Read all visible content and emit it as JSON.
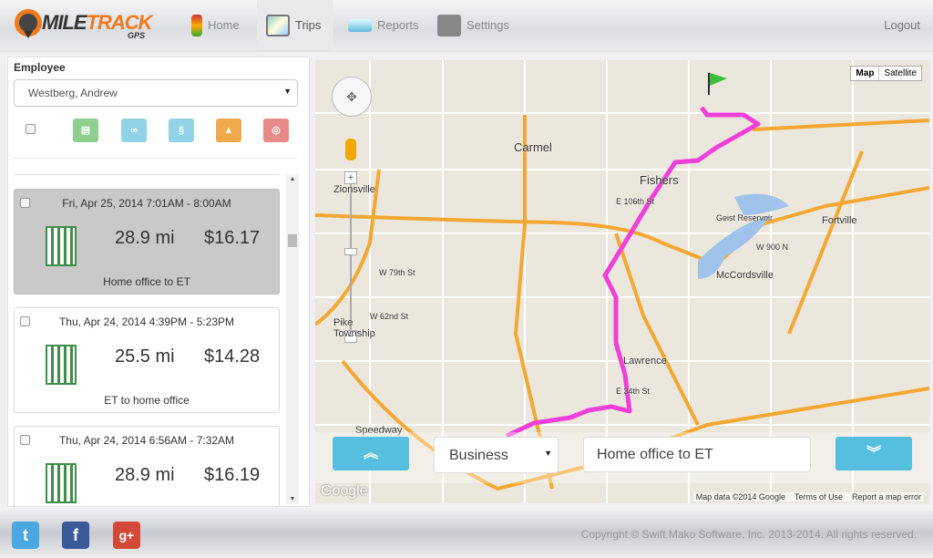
{
  "header": {
    "logo_text_1": "MILE",
    "logo_text_2": "TRACK",
    "logo_sub": "GPS",
    "nav": [
      {
        "label": "Home",
        "icon": "traffic-light-icon"
      },
      {
        "label": "Trips",
        "icon": "gps-map-icon",
        "active": true
      },
      {
        "label": "Reports",
        "icon": "chart-icon"
      },
      {
        "label": "Settings",
        "icon": "gear-shift-icon"
      }
    ],
    "logout": "Logout"
  },
  "sidebar": {
    "employee_label": "Employee",
    "employee_value": "Westberg, Andrew",
    "toolbar": [
      {
        "icon": "document-icon",
        "color": "#8fd08f"
      },
      {
        "icon": "link-icon",
        "color": "#92d3e8"
      },
      {
        "icon": "unlink-icon",
        "color": "#92d3e8"
      },
      {
        "icon": "road-icon",
        "color": "#efa94a"
      },
      {
        "icon": "delete-icon",
        "color": "#e88a8a"
      }
    ],
    "trips": [
      {
        "date": "Fri, Apr 25, 2014 7:01AM - 8:00AM",
        "distance": "28.9 mi",
        "amount": "$16.17",
        "description": "Home office to ET",
        "selected": true
      },
      {
        "date": "Thu, Apr 24, 2014 4:39PM - 5:23PM",
        "distance": "25.5 mi",
        "amount": "$14.28",
        "description": "ET to home office"
      },
      {
        "date": "Thu, Apr 24, 2014 6:56AM - 7:32AM",
        "distance": "28.9 mi",
        "amount": "$16.19",
        "description": ""
      }
    ]
  },
  "map": {
    "type_map": "Map",
    "type_satellite": "Satellite",
    "places": [
      "Carmel",
      "Fishers",
      "Zionsville",
      "Lawrence",
      "McCordsville",
      "Fortville",
      "Speedway",
      "Geist Reservoir",
      "Pike Township",
      "W 79th St",
      "W 62nd St",
      "E 106th St",
      "E 34th St",
      "W 900 N"
    ],
    "route_color": "#ee3fd8",
    "purpose": "Business",
    "description": "Home office to ET",
    "attribution": [
      "Map data ©2014 Google",
      "Terms of Use",
      "Report a map error"
    ],
    "google": "Google"
  },
  "footer": {
    "copyright": "Copyright © Swift Mako Software, Inc. 2013-2014. All rights reserved.",
    "social": [
      "twitter-icon",
      "facebook-icon",
      "google-plus-icon"
    ]
  }
}
